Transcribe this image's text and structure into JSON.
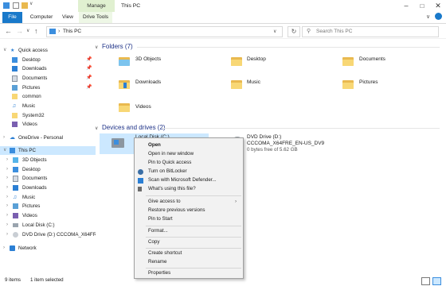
{
  "titlebar": {
    "title": "This PC",
    "manage_tab": "Manage",
    "qat_sep": "∨",
    "minimize": "–",
    "maximize": "□",
    "close": "✕"
  },
  "ribbon": {
    "tabs": [
      "File",
      "Computer",
      "View",
      "Drive Tools"
    ]
  },
  "address": {
    "back": "←",
    "forward": "→",
    "recent": "∨",
    "up": "↑",
    "path_sep": "›",
    "path": "This PC",
    "dropdown": "∨",
    "refresh": "↻",
    "search_placeholder": "Search This PC"
  },
  "nav": {
    "quick_access": "Quick access",
    "quick_items": [
      "Desktop",
      "Downloads",
      "Documents",
      "Pictures",
      "common",
      "Music",
      "System32",
      "Videos"
    ],
    "pin_glyph": "📌",
    "onedrive": "OneDrive - Personal",
    "this_pc": "This PC",
    "this_pc_items": [
      "3D Objects",
      "Desktop",
      "Documents",
      "Downloads",
      "Music",
      "Pictures",
      "Videos",
      "Local Disk (C:)",
      "DVD Drive (D:) CCCOMA_X64FRE_"
    ],
    "network": "Network",
    "expand_glyph": "›",
    "expanded_glyph": "∨"
  },
  "content": {
    "folders_header": "Folders (7)",
    "folders": [
      "3D Objects",
      "Desktop",
      "Documents",
      "Downloads",
      "Music",
      "Pictures",
      "Videos"
    ],
    "drives_header": "Devices and drives (2)",
    "local_disk": "Local Disk (C:)",
    "dvd_name": "DVD Drive (D:)",
    "dvd_label": "CCCOMA_X64FRE_EN-US_DV9",
    "dvd_space": "0 bytes free of 5.62 GB"
  },
  "context_menu": {
    "items": [
      "Open",
      "Open in new window",
      "Pin to Quick access",
      "Turn on BitLocker",
      "Scan with Microsoft Defender...",
      "What's using this file?",
      "Give access to",
      "Restore previous versions",
      "Pin to Start",
      "Format...",
      "Copy",
      "Create shortcut",
      "Rename",
      "Properties"
    ],
    "submenu_arrow": "›"
  },
  "status": {
    "count": "9 items",
    "selected": "1 item selected"
  },
  "colors": {
    "accent": "#1979ca",
    "selection": "#cce8ff",
    "folder": "#f8d775",
    "manage_tab": "#e0f0d0"
  }
}
